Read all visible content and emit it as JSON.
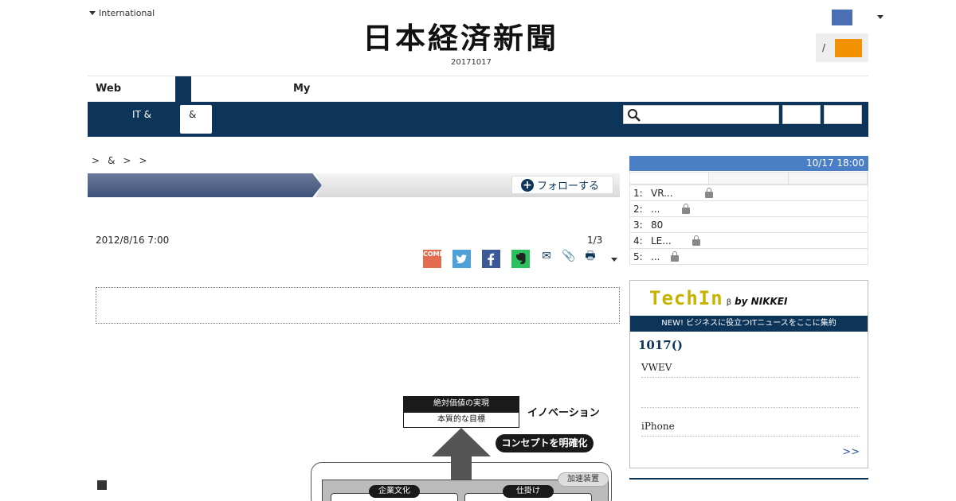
{
  "header": {
    "international": "International",
    "logo_text": "日本経済新聞",
    "issue_date": "20171017",
    "login_slash": "/"
  },
  "top_tabs": {
    "web": "Web",
    "my": "My"
  },
  "nav": {
    "it_label": "IT &",
    "active_label": "&",
    "search_placeholder": ""
  },
  "breadcrumb": [
    ">",
    "&",
    ">",
    ">"
  ],
  "section": {
    "follow_label": "フォローする"
  },
  "article": {
    "date": "2012/8/16 7:00",
    "page": "1/3",
    "comment_label": "COME"
  },
  "figure": {
    "box1": "絶対価値の実現",
    "box2": "本質的な目標",
    "innovation": "イノベーション",
    "concept": "コンセプトを明確化",
    "accelerator": "加速装置",
    "culture": "企業文化",
    "mechanism": "仕掛け"
  },
  "ranking": {
    "timestamp": "10/17 18:00",
    "rows": [
      {
        "num": "1:",
        "text": "VR...",
        "locked": true
      },
      {
        "num": "2:",
        "text": "...",
        "locked": true
      },
      {
        "num": "3:",
        "text": "80",
        "locked": false
      },
      {
        "num": "4:",
        "text": "LE...",
        "locked": true
      },
      {
        "num": "5:",
        "text": "...",
        "locked": true
      }
    ]
  },
  "techin": {
    "word": "TechIn",
    "beta": "β",
    "by": "by NIKKEI",
    "tagline": "NEW! ビジネスに役立つITニュースをここに集約",
    "title": "1017()",
    "items": [
      "VWEV",
      "",
      "iPhone"
    ],
    "more": ">>"
  },
  "colors": {
    "navy": "#0d3459",
    "accent_orange": "#f39200",
    "ranking_blue": "#4a7fc6"
  }
}
